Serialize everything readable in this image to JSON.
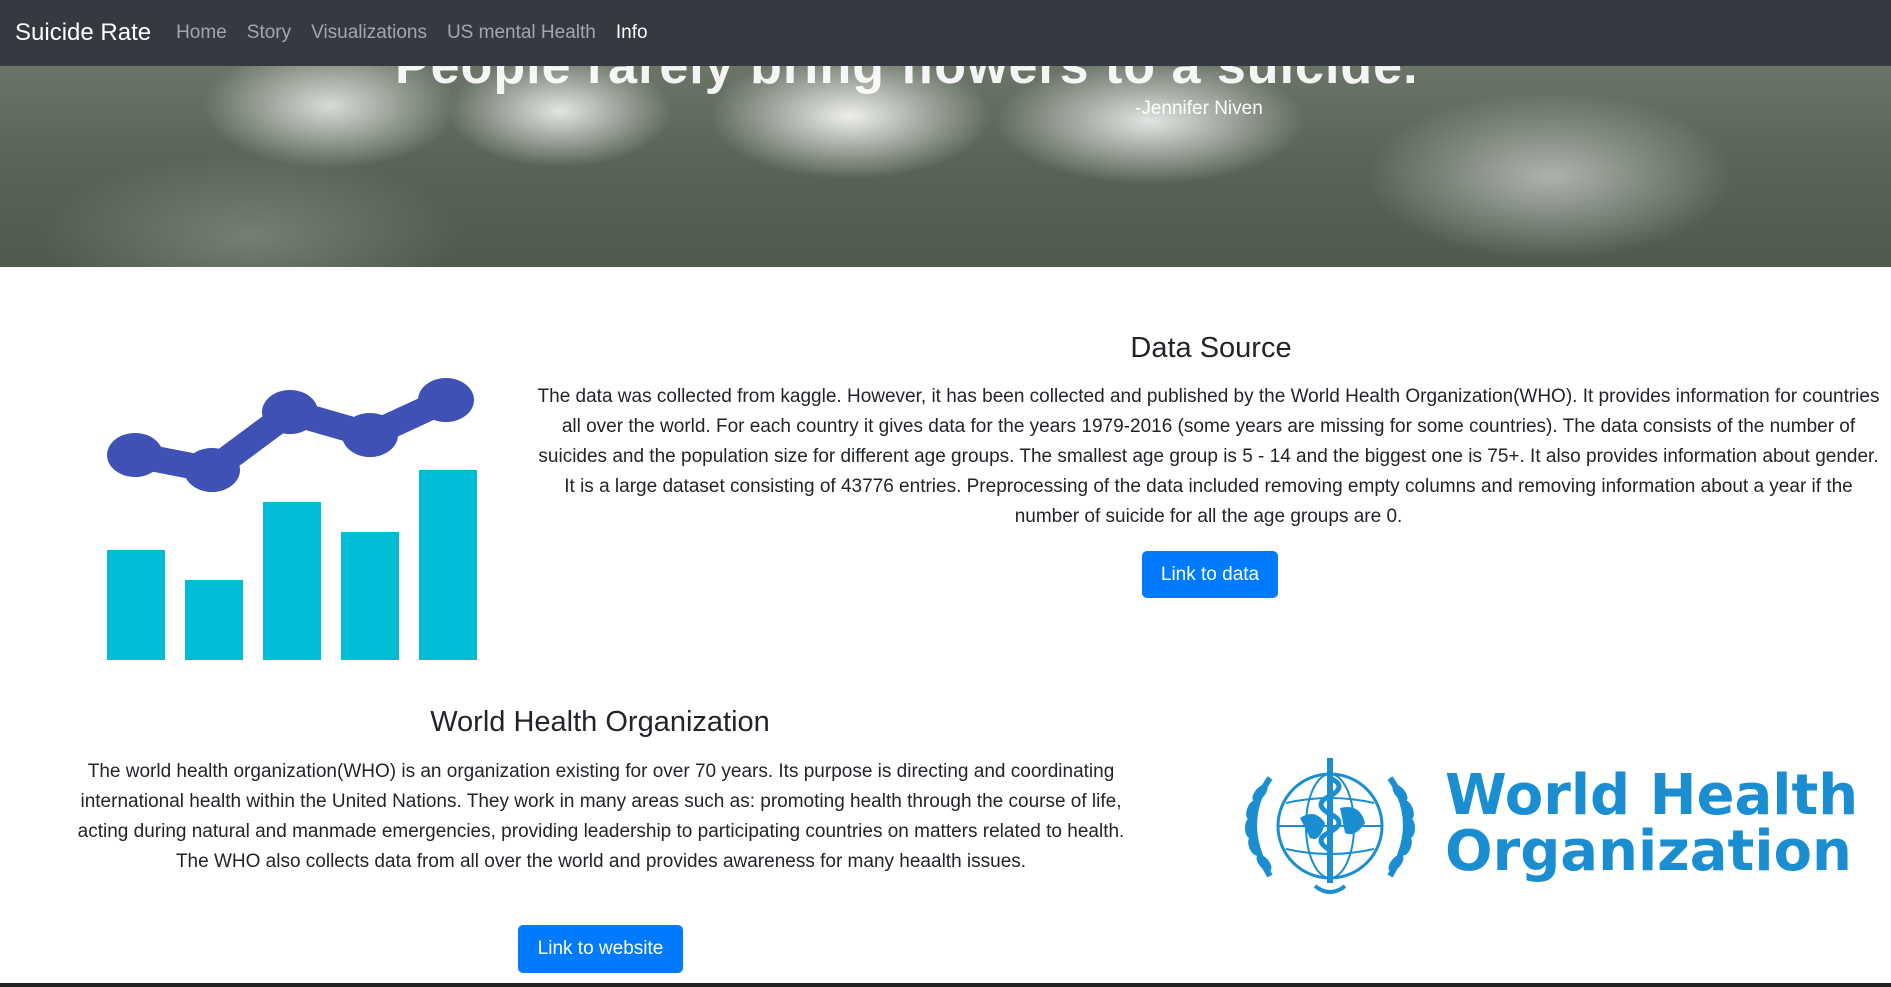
{
  "navbar": {
    "brand": "Suicide Rate",
    "items": [
      {
        "label": "Home",
        "active": false
      },
      {
        "label": "Story",
        "active": false
      },
      {
        "label": "Visualizations",
        "active": false
      },
      {
        "label": "US mental Health",
        "active": false
      },
      {
        "label": "Info",
        "active": true
      }
    ]
  },
  "hero": {
    "quote_partial": "People rarely bring flowers to a suicide.",
    "author": "-Jennifer Niven"
  },
  "data_source": {
    "title": "Data Source",
    "text": "The data was collected from kaggle. However, it has been collected and published by the World Health Organization(WHO). It provides information for countries all over the world. For each country it gives data for the years 1979-2016 (some years are missing for some countries). The data consists of the number of suicides and the population size for different age groups. The smallest age group is 5 - 14 and the biggest one is 75+. It also provides information about gender. It is a large dataset consisting of 43776 entries. Preprocessing of the data included removing empty columns and removing information about a year if the number of suicide for all the age groups are 0.",
    "button_label": "Link to data"
  },
  "who": {
    "title": "World Health Organization",
    "text": "The world health organization(WHO) is an organization existing for over 70 years. Its purpose is directing and coordinating international health within the United Nations. They work in many areas such as: promoting health through the course of life, acting during natural and manmade emergencies, providing leadership to participating countries on matters related to health. The WHO also collects data from all over the world and provides awareness for many heaalth issues.",
    "button_label": "Link to website",
    "logo_line1": "World Health",
    "logo_line2": "Organization"
  },
  "colors": {
    "navbar_bg": "#343a40",
    "primary_button": "#007bff",
    "chart_bar": "#00bcd4",
    "chart_line": "#3f51b5",
    "who_blue": "#1a8ed1"
  }
}
